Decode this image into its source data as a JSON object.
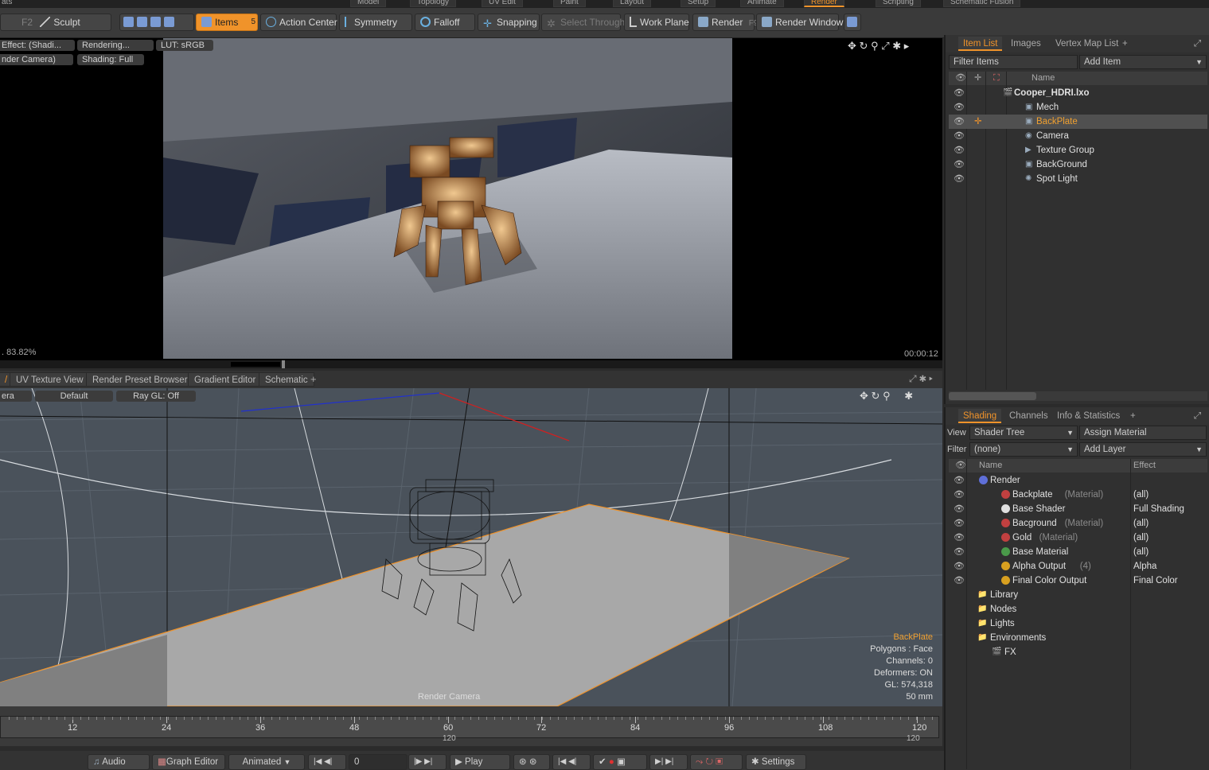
{
  "top_tabs": [
    "Model",
    "Topology",
    "UV Edit",
    "Paint",
    "Layout",
    "Setup",
    "Animate",
    "Render",
    "Scripting",
    "Schematic Fusion"
  ],
  "top_left_text": "ats",
  "toolbar": {
    "f2_label": "F2",
    "sculpt": "Sculpt",
    "items": "Items",
    "items_key": "5",
    "action_center": "Action Center",
    "symmetry": "Symmetry",
    "falloff": "Falloff",
    "snapping": "Snapping",
    "select_through": "Select Through",
    "work_plane": "Work Plane",
    "render": "Render",
    "render_key": "F9",
    "render_window": "Render Window"
  },
  "viewport_top": {
    "effect": "Effect: (Shadi...",
    "rendering": "Rendering...",
    "lut": "LUT: sRGB",
    "camera": "nder Camera)",
    "shading": "Shading: Full",
    "zoom": ". 83.82%",
    "time": "00:00:12"
  },
  "viewport_tabs": [
    "UV Texture View",
    "Render Preset Browser",
    "Gradient Editor",
    "Schematic"
  ],
  "viewport_bottom": {
    "camera": "era",
    "default": "Default",
    "raygl": "Ray GL: Off",
    "center_label": "Render Camera",
    "info": {
      "selected": "BackPlate",
      "polygons": "Polygons : Face",
      "channels": "Channels: 0",
      "deformers": "Deformers: ON",
      "gl": "GL: 574,318",
      "lens": "50 mm"
    }
  },
  "timeline": {
    "ticks": [
      "12",
      "24",
      "36",
      "48",
      "60",
      "72",
      "84",
      "96",
      "108",
      "120"
    ],
    "end_mid": "120",
    "end_right": "120"
  },
  "bottombar": {
    "audio": "Audio",
    "graph_editor": "Graph Editor",
    "animated": "Animated",
    "frame": "0",
    "play": "Play",
    "settings": "Settings"
  },
  "item_list": {
    "tabs": [
      "Item List",
      "Images",
      "Vertex Map List"
    ],
    "filter_placeholder": "Filter Items",
    "add_item": "Add Item",
    "col_name": "Name",
    "items": [
      {
        "label": "Cooper_HDRI.lxo",
        "kind": "scene"
      },
      {
        "label": "Mech",
        "kind": "mesh"
      },
      {
        "label": "BackPlate",
        "kind": "mesh"
      },
      {
        "label": "Camera",
        "kind": "camera"
      },
      {
        "label": "Texture Group",
        "kind": "group"
      },
      {
        "label": "BackGround",
        "kind": "mesh"
      },
      {
        "label": "Spot Light",
        "kind": "light"
      }
    ]
  },
  "shading": {
    "tabs": [
      "Shading",
      "Channels",
      "Info & Statistics"
    ],
    "view_label": "View",
    "view_value": "Shader Tree",
    "assign_material": "Assign Material",
    "filter_label": "Filter",
    "filter_value": "(none)",
    "add_layer": "Add Layer",
    "col_name": "Name",
    "col_effect": "Effect",
    "rows": [
      {
        "name": "Render",
        "type": "",
        "effect": "",
        "color": "#5f6fd8"
      },
      {
        "name": "Backplate",
        "type": "(Material)",
        "effect": "(all)",
        "color": "#c04040"
      },
      {
        "name": "Base Shader",
        "type": "",
        "effect": "Full Shading",
        "color": "#e0e0e0"
      },
      {
        "name": "Bacground",
        "type": "(Material)",
        "effect": "(all)",
        "color": "#c04040"
      },
      {
        "name": "Gold",
        "type": "(Material)",
        "effect": "(all)",
        "color": "#c04040"
      },
      {
        "name": "Base Material",
        "type": "",
        "effect": "(all)",
        "color": "#4a9a4a"
      },
      {
        "name": "Alpha Output",
        "type": "(4)",
        "effect": "Alpha",
        "color": "#d8a020"
      },
      {
        "name": "Final Color Output",
        "type": "",
        "effect": "Final Color",
        "color": "#d8a020"
      },
      {
        "name": "Library",
        "type": "",
        "effect": "",
        "color": ""
      },
      {
        "name": "Nodes",
        "type": "",
        "effect": "",
        "color": ""
      },
      {
        "name": "Lights",
        "type": "",
        "effect": "",
        "color": ""
      },
      {
        "name": "Environments",
        "type": "",
        "effect": "",
        "color": ""
      },
      {
        "name": "FX",
        "type": "",
        "effect": "",
        "color": ""
      }
    ]
  },
  "colors": {
    "accent": "#f0932a",
    "panel": "#303030"
  }
}
